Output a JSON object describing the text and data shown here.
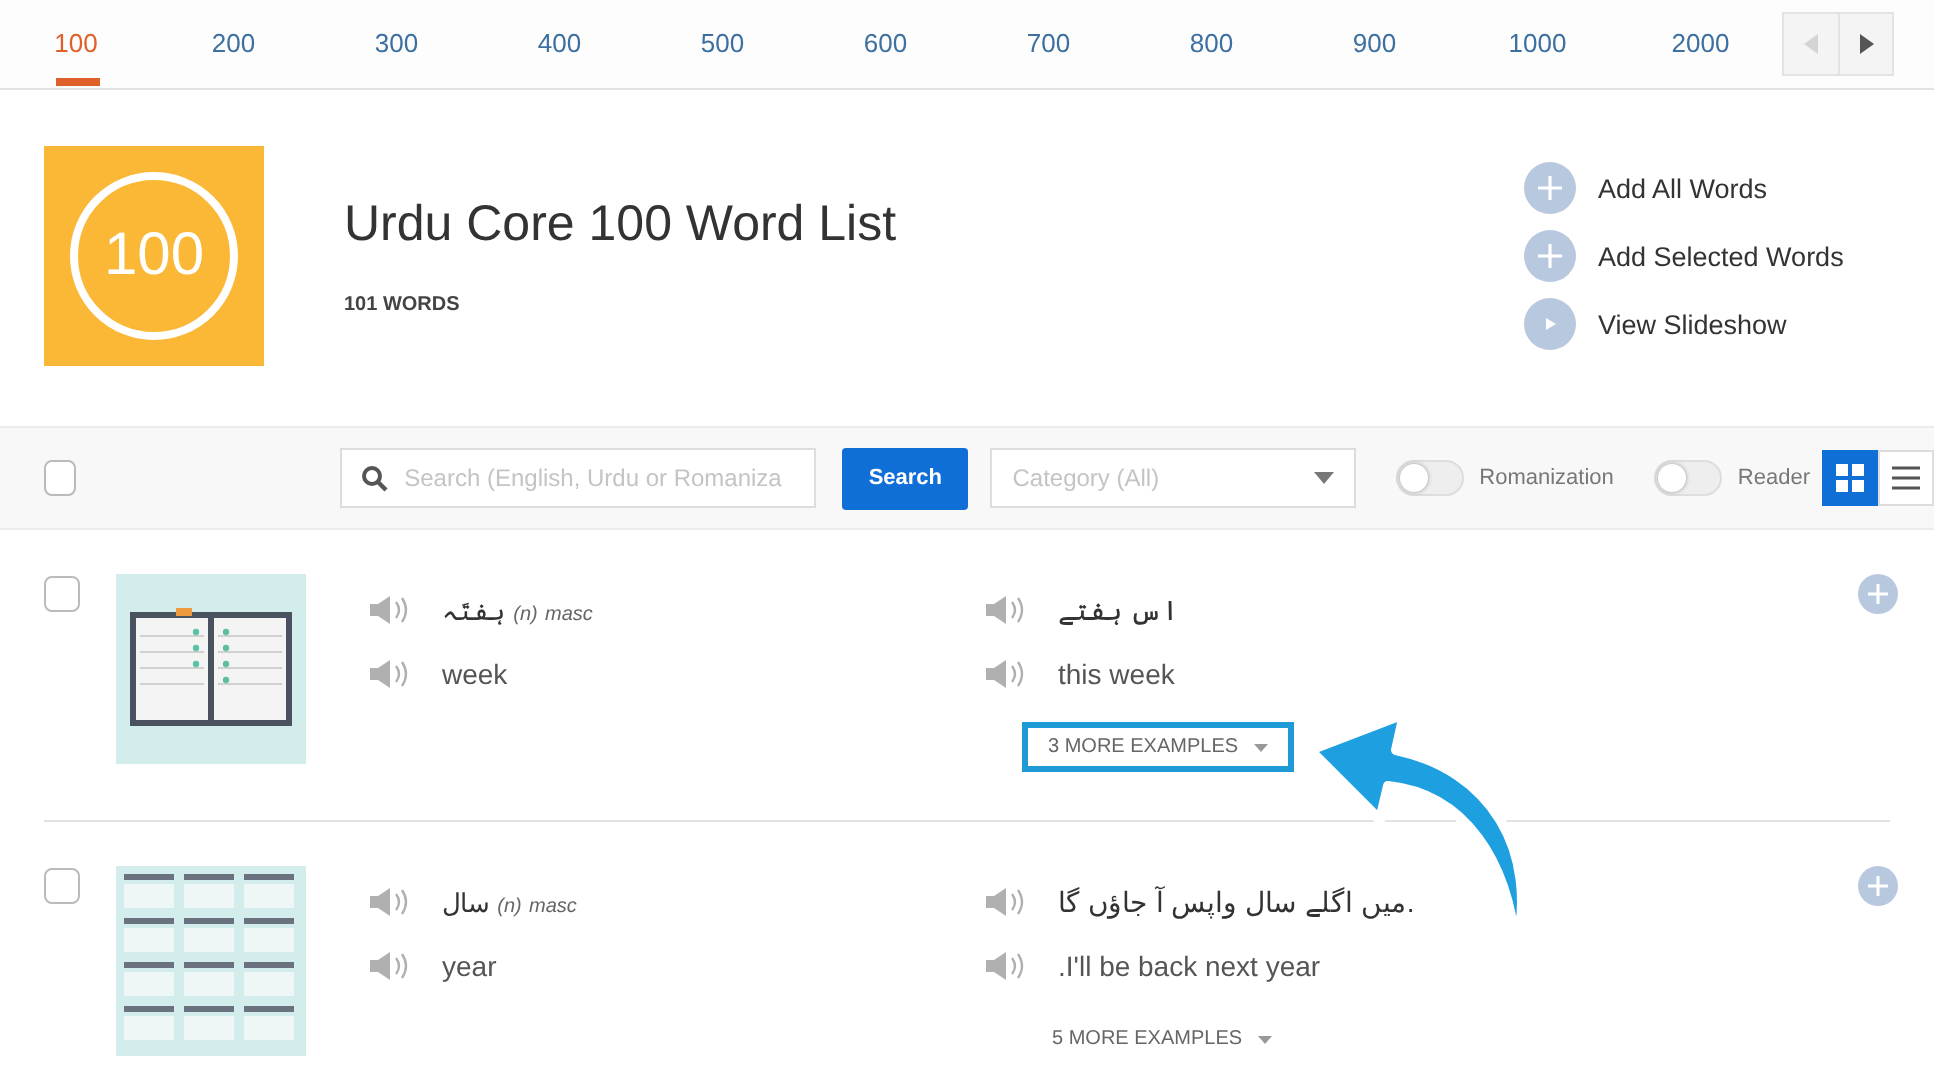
{
  "level_tabs": [
    {
      "label": "100",
      "selected": true
    },
    {
      "label": "200",
      "selected": false
    },
    {
      "label": "300",
      "selected": false
    },
    {
      "label": "400",
      "selected": false
    },
    {
      "label": "500",
      "selected": false
    },
    {
      "label": "600",
      "selected": false
    },
    {
      "label": "700",
      "selected": false
    },
    {
      "label": "800",
      "selected": false
    },
    {
      "label": "900",
      "selected": false
    },
    {
      "label": "1000",
      "selected": false
    },
    {
      "label": "2000",
      "selected": false
    }
  ],
  "pager": {
    "prev_disabled": true,
    "next_disabled": false
  },
  "header": {
    "badge": "100",
    "title": "Urdu Core 100 Word List",
    "count": "101 WORDS",
    "actions": [
      {
        "kind": "add",
        "label": "Add All Words"
      },
      {
        "kind": "add",
        "label": "Add Selected Words"
      },
      {
        "kind": "play",
        "label": "View Slideshow"
      }
    ]
  },
  "toolbar": {
    "select_all_checked": false,
    "search_placeholder": "Search (English, Urdu or Romaniza",
    "search_button": "Search",
    "category_placeholder": "Category (All)",
    "toggles": [
      {
        "label": "Romanization",
        "on": false
      },
      {
        "label": "Reader",
        "on": false
      }
    ],
    "views": [
      {
        "kind": "grid",
        "selected": true
      },
      {
        "kind": "list",
        "selected": false
      }
    ]
  },
  "words": [
    {
      "checked": false,
      "kind": "planner",
      "word": "ہفتَہ",
      "pos": "(n)",
      "gender": "masc",
      "english": "week",
      "example_urdu": "اس ہفتے",
      "example_english": "this week",
      "more": "3 MORE EXAMPLES",
      "highlighted": true
    },
    {
      "checked": false,
      "kind": "calendar",
      "word": "سال",
      "pos": "(n)",
      "gender": "masc",
      "english": "year",
      "example_urdu": "میں اگلے سال واپس آ جاؤں گا.",
      "example_english": ".I'll be back next year",
      "more": "5 MORE EXAMPLES",
      "highlighted": false
    }
  ]
}
